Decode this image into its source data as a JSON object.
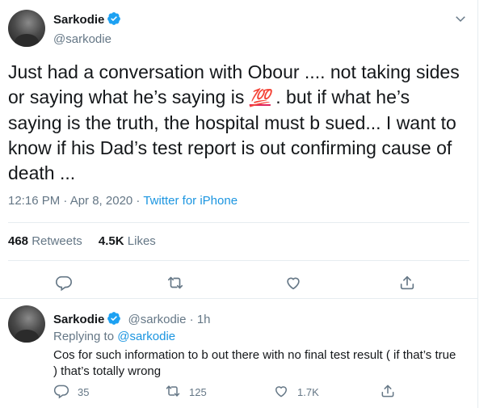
{
  "tweet": {
    "author_name": "Sarkodie",
    "author_handle": "@sarkodie",
    "text_part1": "Just had a conversation with Obour .... not taking sides or saying what he’s saying is ",
    "emoji": "💯",
    "text_part2": " . but if what he’s saying is the truth, the hospital must b sued... I want to know if his Dad’s test report is out confirming cause of death ...",
    "time": "12:16 PM · Apr 8, 2020 · ",
    "source": "Twitter for iPhone",
    "retweets_count": "468",
    "retweets_label": "Retweets",
    "likes_count": "4.5K",
    "likes_label": "Likes"
  },
  "reply": {
    "author_name": "Sarkodie",
    "author_handle": "@sarkodie",
    "age": "· 1h",
    "replying_prefix": "Replying to ",
    "replying_to": "@sarkodie",
    "text": "Cos for such information to b out there with no final test result ( if that’s true ) that’s totally wrong",
    "reply_count": "35",
    "retweet_count": "125",
    "like_count": "1.7K"
  },
  "icons": {
    "verified": "verified-badge-icon",
    "caret": "chevron-down-icon",
    "reply": "reply-icon",
    "retweet": "retweet-icon",
    "like": "heart-icon",
    "share": "share-icon"
  },
  "colors": {
    "accent": "#1da1f2",
    "text": "#14171a",
    "muted": "#657786",
    "divider": "#e6ecf0"
  }
}
